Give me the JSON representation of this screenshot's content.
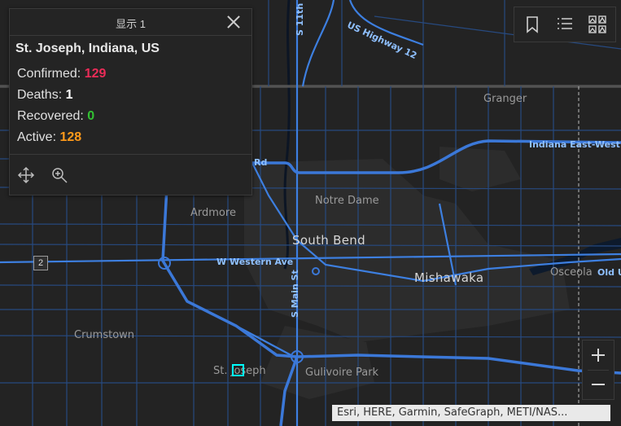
{
  "popup": {
    "header_title": "显示 1",
    "feature_title": "St. Joseph, Indiana, US",
    "rows": [
      {
        "label": "Confirmed:",
        "value": "129"
      },
      {
        "label": "Deaths:",
        "value": "1"
      },
      {
        "label": "Recovered:",
        "value": "0"
      },
      {
        "label": "Active:",
        "value": "128"
      }
    ],
    "footer_icons": [
      "move-icon",
      "zoom-to-icon"
    ]
  },
  "toolbar": {
    "icons": [
      "bookmark-icon",
      "layer-list-icon",
      "basemap-gallery-icon"
    ]
  },
  "zoom": {
    "in_label": "+",
    "out_label": "−"
  },
  "map": {
    "places": {
      "granger": "Granger",
      "notre_dame": "Notre Dame",
      "ardmore": "Ardmore",
      "south_bend": "South Bend",
      "mishawaka": "Mishawaka",
      "osceola": "Osceola",
      "crumstown": "Crumstown",
      "st_joseph": "St. Joseph",
      "gulivoire_park": "Gulivoire Park"
    },
    "roads": {
      "us_highway_12": "US Highway 12",
      "indiana_east_west": "Indiana East-West",
      "w_western_ave": "W Western Ave",
      "s_main_st": "S Main St",
      "s_11th": "S 11th",
      "rd": "Rd",
      "old": "Old U"
    },
    "shield": "2"
  },
  "attribution": "Esri, HERE, Garmin, SafeGraph, METI/NAS...",
  "colors": {
    "background": "#232323",
    "road": "#3d7fe0",
    "confirmed": "#ea2c58",
    "recovered": "#32c232",
    "active": "#ff9a1a",
    "selection": "#00ffff"
  }
}
